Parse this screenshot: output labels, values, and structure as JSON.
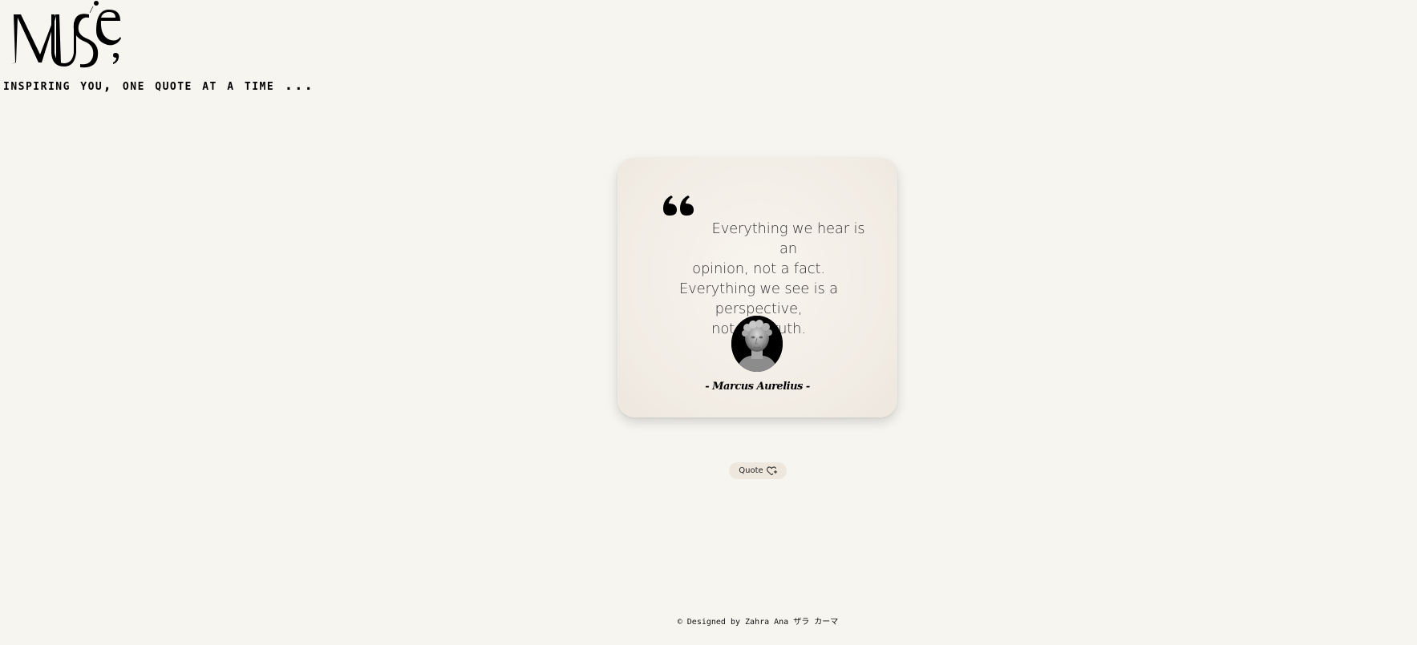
{
  "header": {
    "logo_text": "Muse",
    "tagline": "INSPIRING YOU, ONE QUOTE AT A TIME ..."
  },
  "card": {
    "quote_lines": [
      "Everything we hear is an",
      "opinion, not a fact.",
      "Everything we see is a perspective,",
      "not the truth."
    ],
    "author": "- Marcus Aurelius -",
    "icon": "quote-icon",
    "portrait": "marcus-aurelius-portrait"
  },
  "button": {
    "label": "Quote",
    "icon": "heart-plus-icon"
  },
  "footer": {
    "text": "© Designed by Zahra Ana ザラ カーマ"
  },
  "colors": {
    "background": "#f6f5f0",
    "card": "#f1ece4",
    "text": "#111111"
  }
}
